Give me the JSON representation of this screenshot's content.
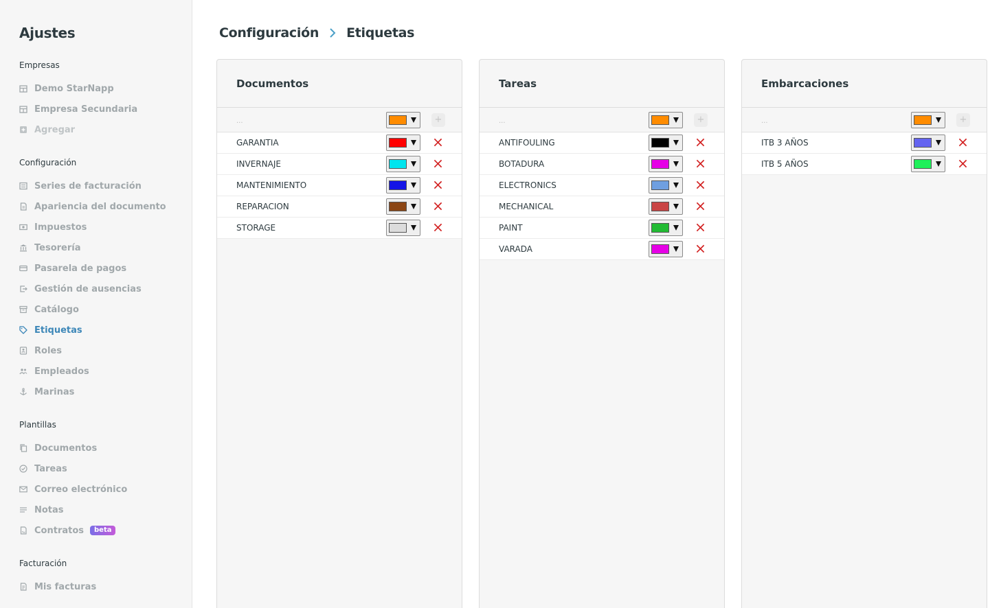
{
  "sidebar": {
    "title": "Ajustes",
    "groups": [
      {
        "label": "Empresas",
        "items": [
          {
            "label": "Demo StarNapp",
            "icon": "building-icon",
            "state": "normal"
          },
          {
            "label": "Empresa Secundaria",
            "icon": "building-icon",
            "state": "normal"
          },
          {
            "label": "Agregar",
            "icon": "plus-square-icon",
            "state": "disabled"
          }
        ]
      },
      {
        "label": "Configuración",
        "items": [
          {
            "label": "Series de facturación",
            "icon": "list-icon",
            "state": "normal"
          },
          {
            "label": "Apariencia del documento",
            "icon": "file-icon",
            "state": "normal"
          },
          {
            "label": "Impuestos",
            "icon": "money-icon",
            "state": "normal"
          },
          {
            "label": "Tesorería",
            "icon": "bank-icon",
            "state": "normal"
          },
          {
            "label": "Pasarela de pagos",
            "icon": "card-icon",
            "state": "normal"
          },
          {
            "label": "Gestión de ausencias",
            "icon": "exit-icon",
            "state": "normal"
          },
          {
            "label": "Catálogo",
            "icon": "archive-icon",
            "state": "normal"
          },
          {
            "label": "Etiquetas",
            "icon": "tag-icon",
            "state": "active"
          },
          {
            "label": "Roles",
            "icon": "id-badge-icon",
            "state": "normal"
          },
          {
            "label": "Empleados",
            "icon": "users-icon",
            "state": "normal"
          },
          {
            "label": "Marinas",
            "icon": "anchor-icon",
            "state": "normal"
          }
        ]
      },
      {
        "label": "Plantillas",
        "items": [
          {
            "label": "Documentos",
            "icon": "copy-icon",
            "state": "normal"
          },
          {
            "label": "Tareas",
            "icon": "check-circle-icon",
            "state": "normal"
          },
          {
            "label": "Correo electrónico",
            "icon": "mail-icon",
            "state": "normal"
          },
          {
            "label": "Notas",
            "icon": "lines-icon",
            "state": "normal"
          },
          {
            "label": "Contratos",
            "icon": "contract-icon",
            "state": "normal",
            "badge": "beta"
          }
        ]
      },
      {
        "label": "Facturación",
        "items": [
          {
            "label": "Mis facturas",
            "icon": "invoice-icon",
            "state": "normal"
          }
        ]
      }
    ]
  },
  "breadcrumb": {
    "parent": "Configuración",
    "current": "Etiquetas"
  },
  "panels": [
    {
      "title": "Documentos",
      "new_row": {
        "placeholder": "...",
        "color": "#ff8c00"
      },
      "tags": [
        {
          "label": "GARANTIA",
          "color": "#ff0000"
        },
        {
          "label": "INVERNAJE",
          "color": "#00e5ee"
        },
        {
          "label": "MANTENIMIENTO",
          "color": "#1414e6"
        },
        {
          "label": "REPARACION",
          "color": "#8b4513"
        },
        {
          "label": "STORAGE",
          "color": "#dcdcdc"
        }
      ]
    },
    {
      "title": "Tareas",
      "new_row": {
        "placeholder": "...",
        "color": "#ff8c00"
      },
      "tags": [
        {
          "label": "ANTIFOULING",
          "color": "#000000"
        },
        {
          "label": "BOTADURA",
          "color": "#e600e6"
        },
        {
          "label": "ELECTRONICS",
          "color": "#6f9fe0"
        },
        {
          "label": "MECHANICAL",
          "color": "#c94444"
        },
        {
          "label": "PAINT",
          "color": "#22bb33"
        },
        {
          "label": "VARADA",
          "color": "#e600e6"
        }
      ]
    },
    {
      "title": "Embarcaciones",
      "new_row": {
        "placeholder": "...",
        "color": "#ff8c00"
      },
      "tags": [
        {
          "label": "ITB 3 AÑOS",
          "color": "#6464f0"
        },
        {
          "label": "ITB 5 AÑOS",
          "color": "#1ef05a"
        }
      ]
    }
  ],
  "colors": {
    "accent": "#3d87b8",
    "delete": "#d21f1f",
    "muted": "#a1a8ab"
  }
}
